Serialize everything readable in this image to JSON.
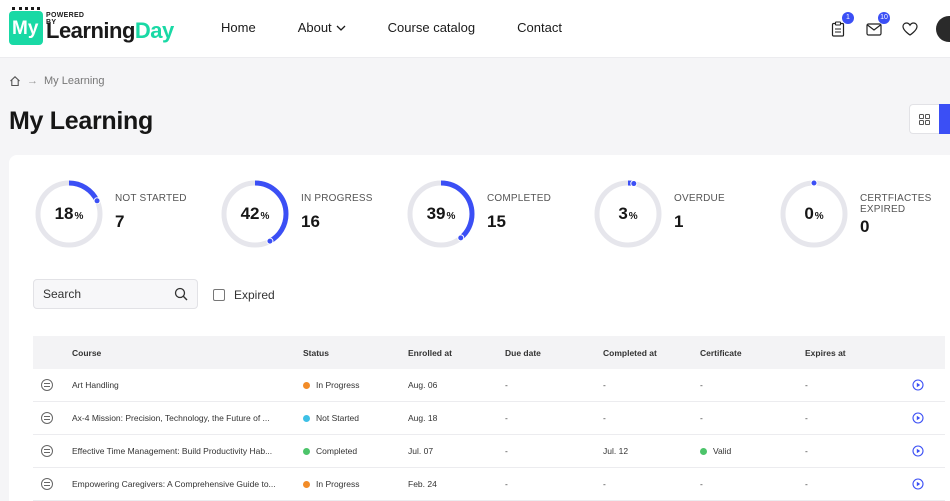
{
  "brand": {
    "powered_by": "POWERED BY",
    "my": "My",
    "learning": "Learning",
    "day": "Day",
    "accent": "#19d9a5"
  },
  "nav": {
    "home": "Home",
    "about": "About",
    "catalog": "Course catalog",
    "contact": "Contact"
  },
  "header_icons": {
    "tasks_badge": "1",
    "messages_badge": "10"
  },
  "breadcrumb": {
    "current": "My Learning"
  },
  "page_title": "My Learning",
  "stats": [
    {
      "label": "NOT STARTED",
      "percent": 18,
      "count": "7",
      "pct_text": "18"
    },
    {
      "label": "IN PROGRESS",
      "percent": 42,
      "count": "16",
      "pct_text": "42"
    },
    {
      "label": "COMPLETED",
      "percent": 39,
      "count": "15",
      "pct_text": "39"
    },
    {
      "label": "OVERDUE",
      "percent": 3,
      "count": "1",
      "pct_text": "3"
    },
    {
      "label": "CERTFIACTES EXPIRED",
      "percent": 0,
      "count": "0",
      "pct_text": "0"
    }
  ],
  "pct_symbol": "%",
  "colors": {
    "progress": "#3b4ff5",
    "track": "#e6e6ec",
    "in_progress": "#f28c28",
    "not_started": "#3ec0e6",
    "completed": "#4cc46a",
    "valid": "#4cc46a"
  },
  "filters": {
    "search_placeholder": "Search",
    "expired_label": "Expired"
  },
  "table": {
    "headers": {
      "course": "Course",
      "status": "Status",
      "enrolled": "Enrolled at",
      "due": "Due date",
      "completed": "Completed at",
      "certificate": "Certificate",
      "expires": "Expires at"
    },
    "rows": [
      {
        "course": "Art Handling",
        "status": "In Progress",
        "status_color": "#f28c28",
        "enrolled": "Aug. 06",
        "due": "-",
        "completed": "-",
        "certificate": "-",
        "expires": "-"
      },
      {
        "course": "Ax-4 Mission: Precision, Technology, the Future of ...",
        "status": "Not Started",
        "status_color": "#3ec0e6",
        "enrolled": "Aug. 18",
        "due": "-",
        "completed": "-",
        "certificate": "-",
        "expires": "-"
      },
      {
        "course": "Effective Time Management: Build Productivity Hab...",
        "status": "Completed",
        "status_color": "#4cc46a",
        "enrolled": "Jul. 07",
        "due": "-",
        "completed": "Jul. 12",
        "certificate": "Valid",
        "expires": "-"
      },
      {
        "course": "Empowering Caregivers: A Comprehensive Guide to...",
        "status": "In Progress",
        "status_color": "#f28c28",
        "enrolled": "Feb. 24",
        "due": "-",
        "completed": "-",
        "certificate": "-",
        "expires": "-"
      }
    ]
  }
}
